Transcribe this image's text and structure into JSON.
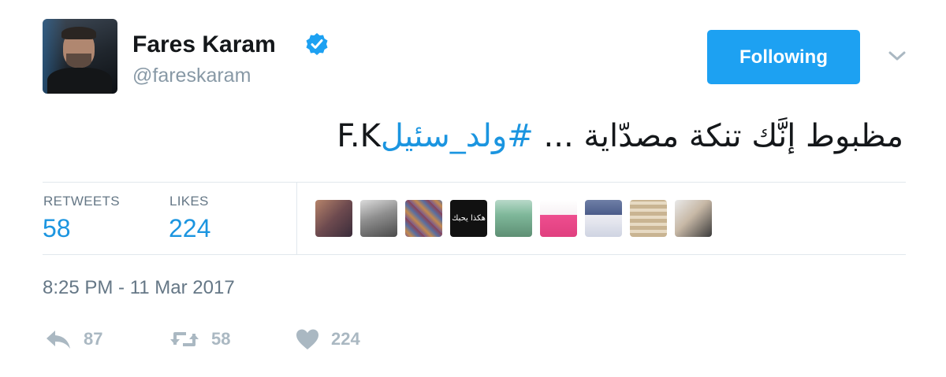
{
  "user": {
    "name": "Fares Karam",
    "handle": "@fareskaram",
    "verified_icon": "verified-badge-icon",
    "avatar_icon": "profile-photo"
  },
  "follow_button": {
    "label": "Following"
  },
  "menu": {
    "icon": "chevron-down-icon"
  },
  "tweet": {
    "text_main": "مظبوط إنَّك تنكة مصدّاية ... ",
    "hashtag": "#ولد_سئيل",
    "text_tail": " F.K"
  },
  "stats": {
    "retweets_label": "RETWEETS",
    "retweets_value": "58",
    "likes_label": "LIKES",
    "likes_value": "224"
  },
  "likers": [
    {
      "icon": "liker-avatar"
    },
    {
      "icon": "liker-avatar"
    },
    {
      "icon": "liker-avatar"
    },
    {
      "icon": "liker-avatar",
      "text": "هكذا يحبك"
    },
    {
      "icon": "liker-avatar"
    },
    {
      "icon": "liker-avatar"
    },
    {
      "icon": "liker-avatar"
    },
    {
      "icon": "liker-avatar"
    },
    {
      "icon": "liker-avatar"
    }
  ],
  "timestamp": "8:25 PM - 11 Mar 2017",
  "actions": {
    "reply": {
      "icon": "reply-icon",
      "count": "87"
    },
    "retweet": {
      "icon": "retweet-icon",
      "count": "58"
    },
    "like": {
      "icon": "heart-icon",
      "count": "224"
    }
  },
  "colors": {
    "accent": "#1da1f2",
    "link": "#1b95e0",
    "muted": "#657786",
    "action_gray": "#aab8c2",
    "border": "#e1e8ed"
  }
}
